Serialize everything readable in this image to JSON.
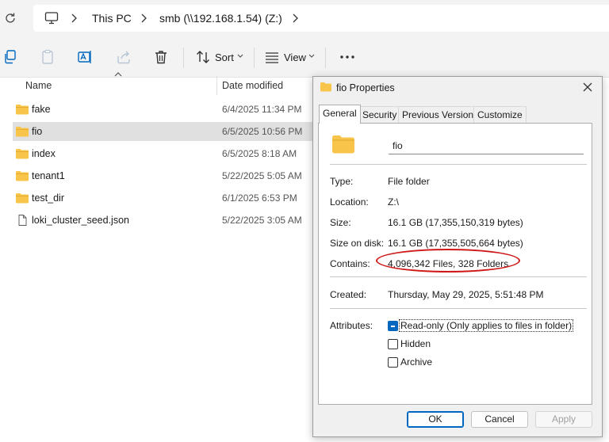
{
  "breadcrumb": {
    "items": [
      "This PC",
      "smb (\\\\192.168.1.54) (Z:)"
    ]
  },
  "toolbar": {
    "sort_label": "Sort",
    "view_label": "View"
  },
  "file_list": {
    "columns": {
      "name": "Name",
      "date": "Date modified"
    },
    "rows": [
      {
        "name": "fake",
        "date": "6/4/2025 11:34 PM",
        "type": "folder"
      },
      {
        "name": "fio",
        "date": "6/5/2025 10:56 PM",
        "type": "folder",
        "selected": true
      },
      {
        "name": "index",
        "date": "6/5/2025 8:18 AM",
        "type": "folder"
      },
      {
        "name": "tenant1",
        "date": "5/22/2025 5:05 AM",
        "type": "folder"
      },
      {
        "name": "test_dir",
        "date": "6/1/2025 6:53 PM",
        "type": "folder"
      },
      {
        "name": "loki_cluster_seed.json",
        "date": "5/22/2025 3:05 AM",
        "type": "file"
      }
    ]
  },
  "dialog": {
    "title": "fio Properties",
    "tabs": [
      "General",
      "Security",
      "Previous Versions",
      "Customize"
    ],
    "active_tab": "General",
    "folder_name": "fio",
    "props": {
      "type_label": "Type:",
      "type_value": "File folder",
      "location_label": "Location:",
      "location_value": "Z:\\",
      "size_label": "Size:",
      "size_value": "16.1 GB (17,355,150,319 bytes)",
      "size_on_disk_label": "Size on disk:",
      "size_on_disk_value": "16.1 GB (17,355,505,664 bytes)",
      "contains_label": "Contains:",
      "contains_value": "4,096,342 Files, 328 Folders",
      "created_label": "Created:",
      "created_value": "Thursday, May 29, 2025, 5:51:48 PM",
      "attributes_label": "Attributes:"
    },
    "attributes": {
      "readonly_label": "Read-only (Only applies to files in folder)",
      "readonly_state": "indeterminate",
      "hidden_label": "Hidden",
      "archive_label": "Archive"
    },
    "buttons": {
      "ok": "OK",
      "cancel": "Cancel",
      "apply": "Apply"
    }
  },
  "colors": {
    "accent": "#0067c0",
    "annotation": "#d01818",
    "folder": "#f8c54a",
    "selection": "#e0e0e0"
  }
}
